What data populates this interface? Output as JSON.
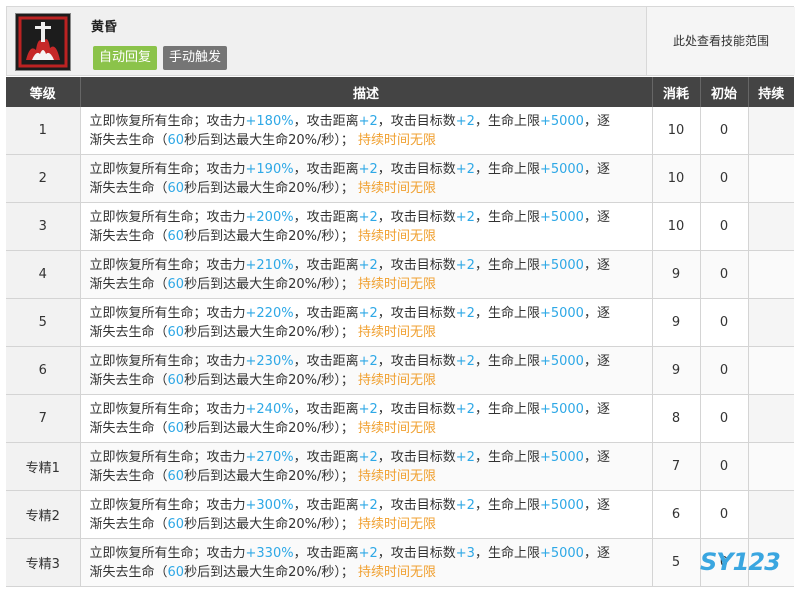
{
  "skill": {
    "name": "黄昏",
    "tag_auto": "自动回复",
    "tag_manual": "手动触发",
    "range_label": "此处查看技能范围"
  },
  "columns": {
    "level": "等级",
    "desc": "描述",
    "cost": "消耗",
    "initial": "初始",
    "duration": "持续"
  },
  "rows": [
    {
      "level": "1",
      "atk": "+180%",
      "range": "+2",
      "targets": "+2",
      "hp": "+5000",
      "secs": "60",
      "cost": "10",
      "initial": "0",
      "duration": ""
    },
    {
      "level": "2",
      "atk": "+190%",
      "range": "+2",
      "targets": "+2",
      "hp": "+5000",
      "secs": "60",
      "cost": "10",
      "initial": "0",
      "duration": ""
    },
    {
      "level": "3",
      "atk": "+200%",
      "range": "+2",
      "targets": "+2",
      "hp": "+5000",
      "secs": "60",
      "cost": "10",
      "initial": "0",
      "duration": ""
    },
    {
      "level": "4",
      "atk": "+210%",
      "range": "+2",
      "targets": "+2",
      "hp": "+5000",
      "secs": "60",
      "cost": "9",
      "initial": "0",
      "duration": ""
    },
    {
      "level": "5",
      "atk": "+220%",
      "range": "+2",
      "targets": "+2",
      "hp": "+5000",
      "secs": "60",
      "cost": "9",
      "initial": "0",
      "duration": ""
    },
    {
      "level": "6",
      "atk": "+230%",
      "range": "+2",
      "targets": "+2",
      "hp": "+5000",
      "secs": "60",
      "cost": "9",
      "initial": "0",
      "duration": ""
    },
    {
      "level": "7",
      "atk": "+240%",
      "range": "+2",
      "targets": "+2",
      "hp": "+5000",
      "secs": "60",
      "cost": "8",
      "initial": "0",
      "duration": ""
    },
    {
      "level": "专精1",
      "atk": "+270%",
      "range": "+2",
      "targets": "+2",
      "hp": "+5000",
      "secs": "60",
      "cost": "7",
      "initial": "0",
      "duration": ""
    },
    {
      "level": "专精2",
      "atk": "+300%",
      "range": "+2",
      "targets": "+2",
      "hp": "+5000",
      "secs": "60",
      "cost": "6",
      "initial": "0",
      "duration": ""
    },
    {
      "level": "专精3",
      "atk": "+330%",
      "range": "+2",
      "targets": "+3",
      "hp": "+5000",
      "secs": "60",
      "cost": "5",
      "initial": "0",
      "duration": ""
    }
  ],
  "desc_text": {
    "p1": "立即恢复所有生命；攻击力",
    "p2": "，攻击距离",
    "p3": "，攻击目标数",
    "p4": "，生命上限",
    "p5": "，逐",
    "p6": "渐失去生命（",
    "p7": "秒后到达最大生命20%/秒）；",
    "dur": "持续时间无限"
  },
  "watermark": "SY123",
  "colors": {
    "highlight": "#2ea8e6",
    "duration": "#f0a030",
    "header": "#444444",
    "auto_tag": "#8bc34a"
  },
  "icon_name": "skill-icon"
}
